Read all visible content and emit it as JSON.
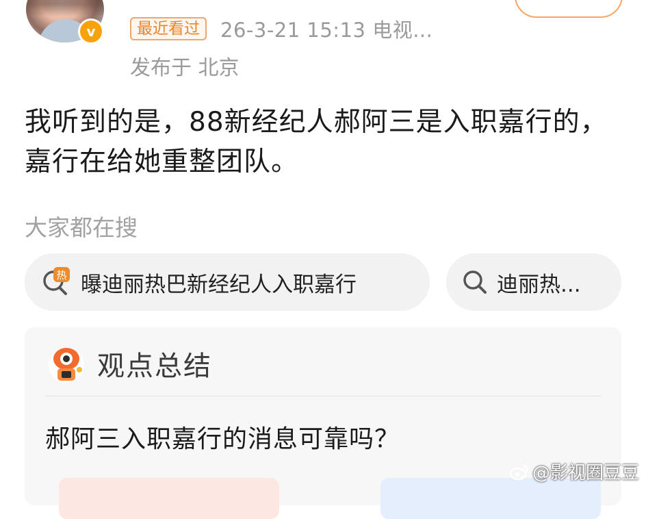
{
  "post": {
    "recent_tag": "最近看过",
    "meta": "26-3-21 15:13  电视...",
    "location": "发布于 北京",
    "content": "我听到的是，88新经纪人郝阿三是入职嘉行的，嘉行在给她重整团队。"
  },
  "search": {
    "title": "大家都在搜",
    "chips": [
      {
        "text": "曝迪丽热巴新经纪人入职嘉行",
        "icon": "hot-search-icon"
      },
      {
        "text": "迪丽热...",
        "icon": "search-icon"
      }
    ]
  },
  "summary": {
    "title": "观点总结",
    "question": "郝阿三入职嘉行的消息可靠吗？"
  },
  "watermark": "@影视圈豆豆",
  "colors": {
    "accent_orange": "#e8862f",
    "verify_gold": "#f7a20b",
    "meta_gray": "#9a9a9a"
  }
}
